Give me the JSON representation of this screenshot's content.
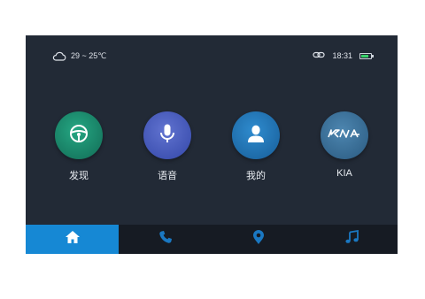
{
  "status": {
    "weather_icon": "cloud-icon",
    "temperature": "29 ~ 25℃",
    "link_icon": "link-icon",
    "time": "18:31",
    "battery_icon": "battery-icon",
    "battery_level": 0.8
  },
  "apps": [
    {
      "label": "发现",
      "icon": "steering-wheel-icon",
      "color": "#1f8d6f"
    },
    {
      "label": "语音",
      "icon": "microphone-icon",
      "color": "#4a5bc0"
    },
    {
      "label": "我的",
      "icon": "user-icon",
      "color": "#2576b6"
    },
    {
      "label": "KIA",
      "icon": "kia-logo",
      "color": "#3b739e",
      "logo_text": "KIA"
    }
  ],
  "dock": {
    "items": [
      {
        "icon": "home-icon",
        "active": true
      },
      {
        "icon": "phone-icon",
        "active": false
      },
      {
        "icon": "map-pin-icon",
        "active": false
      },
      {
        "icon": "music-icon",
        "active": false
      }
    ],
    "active_color": "#1688d4",
    "inactive_icon_color": "#1a78c2"
  }
}
